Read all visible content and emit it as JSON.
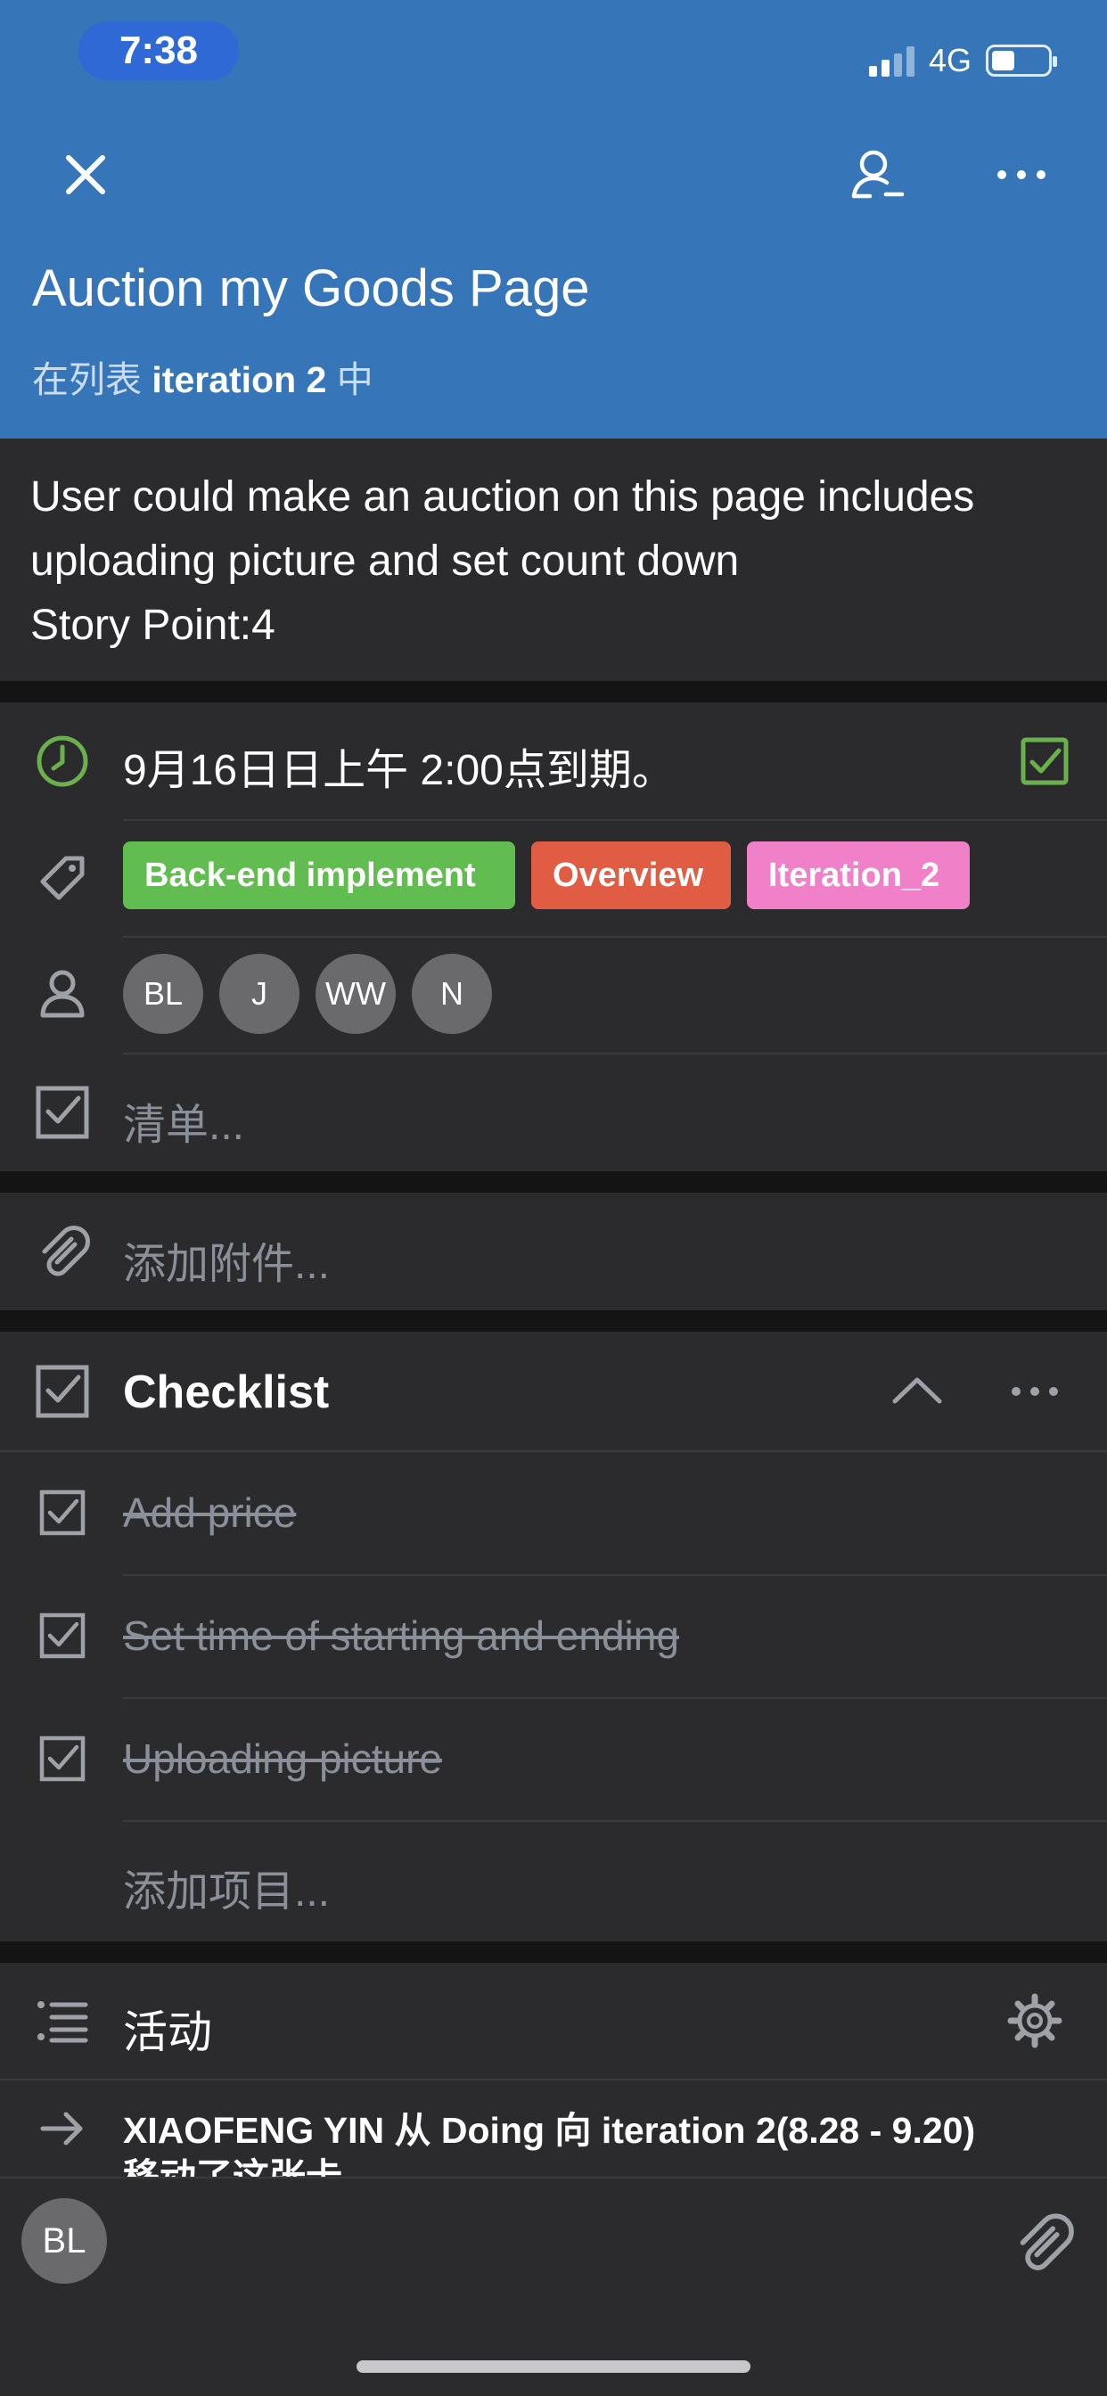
{
  "status_bar": {
    "time": "7:38",
    "network": "4G",
    "battery_level": 0.4,
    "signal_bars": 4,
    "signal_active": 2
  },
  "header": {
    "title": "Auction my Goods Page",
    "list_prefix": "在列表 ",
    "list_name": "iteration 2",
    "list_suffix": " 中",
    "background": "#3575b8",
    "icons": [
      "close-icon",
      "remove-member-icon",
      "more-icon"
    ]
  },
  "description": {
    "text": "User could make an auction on this page includes\nuploading picture and set count down\nStory Point:4"
  },
  "due": {
    "text": "9月16日日上午 2:00点到期。",
    "completed": true,
    "accent": "#6ab04c"
  },
  "labels": [
    {
      "name": "Back-end implement",
      "color": "#61bd4f"
    },
    {
      "name": "Overview",
      "color": "#e05d44"
    },
    {
      "name": "Iteration_2",
      "color": "#f080c8"
    }
  ],
  "members": [
    "BL",
    "J",
    "WW",
    "N"
  ],
  "checklist_placeholder": "清单...",
  "attachment_placeholder": "添加附件...",
  "checklist": {
    "title": "Checklist",
    "items": [
      {
        "text": "Add price",
        "checked": true
      },
      {
        "text": "Set time of starting and ending",
        "checked": true
      },
      {
        "text": "Uploading picture",
        "checked": true
      }
    ],
    "add_item": "添加项目..."
  },
  "activity": {
    "title": "活动",
    "entry_line1": "XIAOFENG YIN 从 Doing 向 iteration 2(8.28 - 9.20)",
    "entry_line2": "移动了这张卡"
  },
  "footer": {
    "avatar": "BL"
  }
}
